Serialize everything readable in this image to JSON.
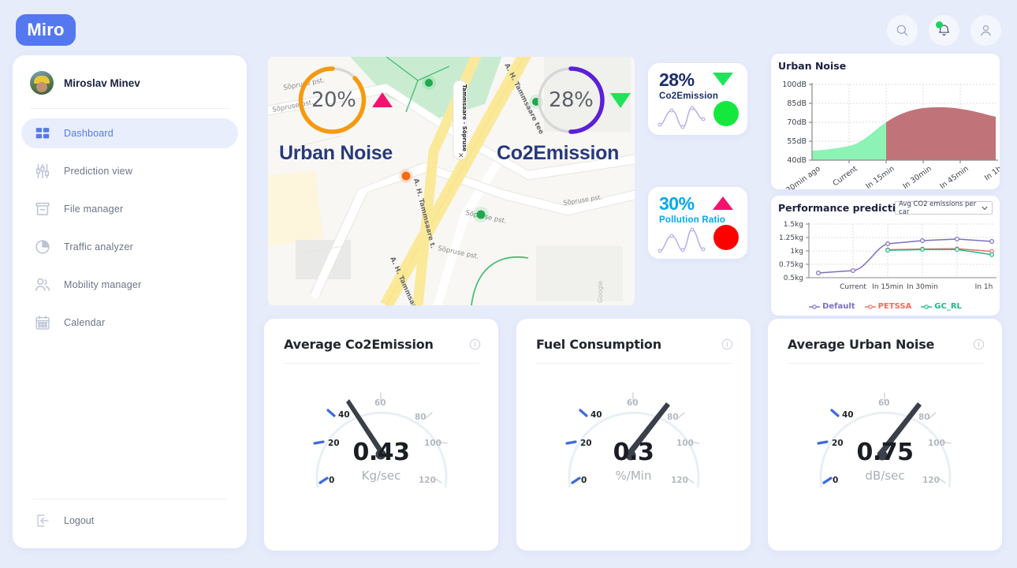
{
  "brand": {
    "name": "Miro",
    "color": "#5578f0"
  },
  "header": {
    "search_icon": "search-icon",
    "notifications_icon": "bell-icon",
    "profile_icon": "user-icon"
  },
  "sidebar": {
    "user": {
      "name": "Miroslav Minev"
    },
    "items": [
      {
        "label": "Dashboard",
        "icon": "grid-icon",
        "active": true
      },
      {
        "label": "Prediction view",
        "icon": "sliders-icon",
        "active": false
      },
      {
        "label": "File manager",
        "icon": "archive-icon",
        "active": false
      },
      {
        "label": "Traffic analyzer",
        "icon": "pie-chart-icon",
        "active": false
      },
      {
        "label": "Mobility manager",
        "icon": "users-icon",
        "active": false
      },
      {
        "label": "Calendar",
        "icon": "calendar-icon",
        "active": false
      }
    ],
    "logout": {
      "label": "Logout",
      "icon": "logout-icon"
    }
  },
  "map": {
    "streets": [
      "A. H. Tammsaare tee",
      "Sõpruse pst.",
      "Sõpruse pst.",
      "Sõpruse pst.",
      "Sõpruse pst."
    ],
    "label_marker": "Tammsaare - Sõpruse",
    "attribution": "Google",
    "overlays": [
      {
        "name": "Urban Noise",
        "percent": "20%",
        "ring_color": "#f59a10",
        "ring_pct": 75,
        "trend": "up",
        "trend_color": "#f5136d"
      },
      {
        "name": "Co2Emission",
        "percent": "28%",
        "ring_color": "#5b21d6",
        "ring_pct": 50,
        "trend": "down",
        "trend_color": "#21e25a"
      }
    ]
  },
  "stats": [
    {
      "percent": "28%",
      "name": "Co2Emission",
      "value_color": "#1b2d6b",
      "name_color": "#1b2d6b",
      "trend": "down",
      "trend_color": "#20e35a",
      "dot_color": "#15e83c",
      "spark": [
        18,
        6,
        2,
        14,
        26,
        3,
        11,
        15
      ]
    },
    {
      "percent": "30%",
      "name": "Pollution Ratio",
      "value_color": "#00a9ef",
      "name_color": "#00a9ef",
      "trend": "up",
      "trend_color": "#f5136d",
      "dot_color": "#fe0000",
      "spark": [
        2,
        4,
        20,
        3,
        26,
        6,
        2,
        8
      ]
    }
  ],
  "urban_noise_panel": {
    "title": "Urban Noise"
  },
  "performance_panel": {
    "title": "Performance predictions",
    "select_value": "Avg CO2 emissions per car",
    "select_options": [
      "Avg CO2 emissions per car"
    ]
  },
  "gauge_cards": [
    {
      "title": "Average Co2Emission",
      "value": "0.43",
      "unit": "Kg/sec",
      "needle_value": 58,
      "info_icon": "info-icon"
    },
    {
      "title": "Fuel Consumption",
      "value": "0.3",
      "unit": "%/Min",
      "needle_value": 78,
      "info_icon": "info-icon"
    },
    {
      "title": "Average Urban Noise",
      "value": "0.75",
      "unit": "dB/sec",
      "needle_value": 78,
      "info_icon": "info-icon"
    }
  ],
  "gauge_scale": {
    "ticks": [
      "0",
      "20",
      "40",
      "60",
      "80",
      "100",
      "120"
    ],
    "min": 0,
    "max": 120,
    "active_color": "#3e6ae1",
    "inactive_color": "#c9cfda"
  },
  "chart_data": [
    {
      "type": "area",
      "title": "Urban Noise",
      "xlabel": "",
      "ylabel": "",
      "categories": [
        "30min ago",
        "Current",
        "In 15min",
        "In 30min",
        "In 45min",
        "In 1h"
      ],
      "tick_labels_y": [
        "40dB",
        "55dB",
        "70dB",
        "85dB",
        "100dB"
      ],
      "ylim": [
        40,
        100
      ],
      "grid": true,
      "legend": "none",
      "series": [
        {
          "name": "past",
          "color": "#7cf0a8",
          "values": [
            48,
            51,
            70
          ]
        },
        {
          "name": "forecast",
          "color": "#c1737a",
          "values": [
            70,
            77,
            79,
            78,
            76
          ]
        }
      ],
      "x_values": [
        0,
        0.5,
        1.0,
        1.4,
        1.8,
        2.2,
        2.6,
        3.0
      ],
      "values": [
        48,
        49,
        51,
        56,
        70,
        77,
        79,
        78,
        76
      ]
    },
    {
      "type": "line",
      "title": "Performance predictions",
      "xlabel": "",
      "ylabel": "",
      "categories": [
        "",
        "Current",
        "In 15min",
        "In 30min",
        "",
        "In 1h"
      ],
      "tick_labels_y": [
        "0.5kg",
        "0.75kg",
        "1kg",
        "1.25kg",
        "1.5kg"
      ],
      "ylim": [
        0.5,
        1.5
      ],
      "grid": true,
      "legend": "bottom",
      "series": [
        {
          "name": "Default",
          "color": "#7b6fc4",
          "values": [
            0.6,
            0.645,
            1.215,
            1.27,
            1.3,
            1.265
          ]
        },
        {
          "name": "PETSSA",
          "color": "#f96a5a",
          "values": [
            null,
            null,
            1.125,
            1.14,
            1.145,
            1.095
          ]
        },
        {
          "name": "GC_RL",
          "color": "#1db98a",
          "values": [
            null,
            null,
            1.12,
            1.135,
            1.135,
            1.035
          ]
        }
      ]
    }
  ]
}
